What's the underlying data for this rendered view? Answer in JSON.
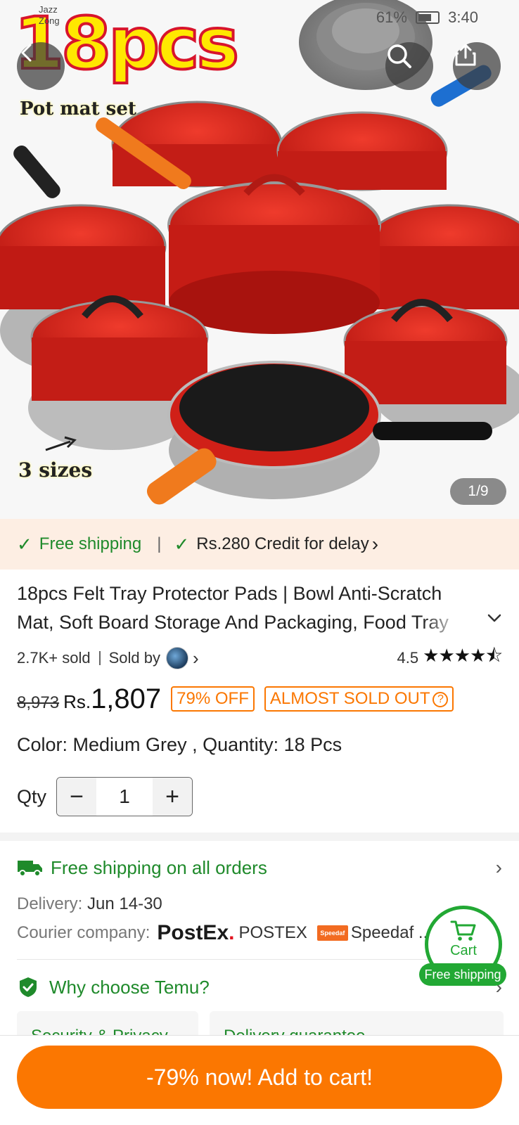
{
  "status_bar": {
    "carrier_1": "Jazz",
    "carrier_2": "Zong",
    "battery": "61%",
    "time": "3:40"
  },
  "hero": {
    "promo_title": "18pcs",
    "promo_subtitle": "Pot mat set",
    "promo_sizes": "3 sizes",
    "pager": "1/9",
    "icons": [
      "back-arrow-icon",
      "search-icon",
      "share-icon"
    ]
  },
  "shipping_strip": {
    "free_shipping": "Free shipping",
    "credit": "Rs.280 Credit for delay",
    "credit_chevron": "›"
  },
  "product": {
    "title": "18pcs Felt Tray Protector Pads | Bowl Anti-Scratch Mat, Soft Board Storage And Packaging, Food Tray",
    "sold": "2.7K+ sold",
    "sold_by": "Sold by",
    "rating": "4.5",
    "stars": "★★★★⯪",
    "original_price": "8,973",
    "currency": "Rs.",
    "price": "1,807",
    "discount_tag": "79% OFF",
    "stock_tag": "ALMOST SOLD OUT",
    "stock_help": "?",
    "variant": "Color: Medium Grey , Quantity: 18 Pcs",
    "qty_label": "Qty",
    "qty_value": "1",
    "qty_minus": "−",
    "qty_plus": "+"
  },
  "delivery": {
    "free_all": "Free shipping on all orders",
    "delivery_label": "Delivery:",
    "delivery_dates": "Jun 14-30",
    "courier_label": "Courier company:",
    "postex_logo": "PostEx",
    "postex_dot": ".",
    "postex_name": "POSTEX",
    "speedaf_logo": "Speedaf",
    "speedaf_name": "Speedaf ..."
  },
  "why_temu": {
    "title": "Why choose Temu?",
    "cards": [
      "Security & Privacy",
      "Delivery guarantee"
    ]
  },
  "cart_float": {
    "label": "Cart",
    "badge": "Free shipping"
  },
  "cta": {
    "label": "-79% now! Add to cart!"
  },
  "colors": {
    "accent_orange": "#fb7701",
    "green": "#1f8a2b",
    "pot_red": "#d7261e"
  }
}
